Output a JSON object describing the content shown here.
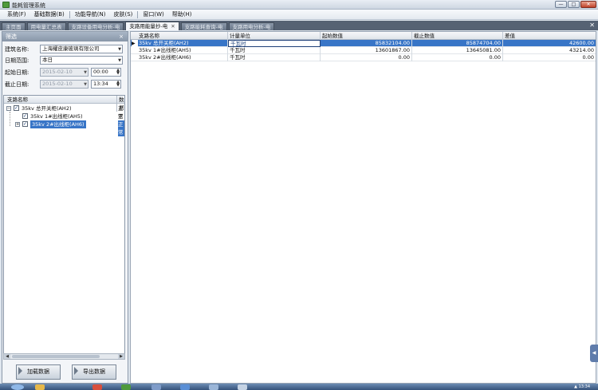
{
  "window": {
    "title": "能耗管理系统",
    "min": "—",
    "max": "□",
    "close": "✕"
  },
  "menu": [
    "系统(F)",
    "基础数据(B)",
    "功能导航(N)",
    "皮肤(S)",
    "窗口(W)",
    "帮助(H)"
  ],
  "tabs": [
    {
      "label": "主页面",
      "active": false
    },
    {
      "label": "用电量汇总表",
      "active": false
    },
    {
      "label": "支路设备用电分析-电",
      "active": false
    },
    {
      "label": "支路用能量抄-电",
      "active": true
    },
    {
      "label": "支路能耗查询-电",
      "active": false
    },
    {
      "label": "支路用电分析-电",
      "active": false
    }
  ],
  "tab_close_glyph": "✕",
  "filter": {
    "header": "筛选",
    "pin": "×",
    "building_label": "建筑名称:",
    "building_value": "上海耀皮康玻璃有限公司",
    "range_label": "日期范围:",
    "range_value": "本日",
    "start_label": "起始日期:",
    "start_date": "2015-02-10",
    "start_time": "00:00",
    "end_label": "截止日期:",
    "end_date": "2015-02-10",
    "end_time": "13:34"
  },
  "tree": {
    "col1": "支路名称",
    "col2": "数据",
    "items": [
      {
        "label": "35kv 总开关柜(AH2)",
        "status": "正常",
        "checked": true,
        "level": 0,
        "expander": "−",
        "selected": false
      },
      {
        "label": "35kv 1#出线柜(AH5)",
        "status": "正常",
        "checked": true,
        "level": 1,
        "expander": "",
        "selected": false
      },
      {
        "label": "35kv 2#出线柜(AH6)",
        "status": "正常",
        "checked": true,
        "level": 1,
        "expander": "+",
        "selected": true
      }
    ]
  },
  "buttons": {
    "load": "加载数据",
    "export": "导出数据"
  },
  "grid": {
    "columns": [
      "支路名称",
      "计量单位",
      "起始数值",
      "截止数值",
      "差值"
    ],
    "rows": [
      {
        "name": "35kv 总开关柜(AH2)",
        "unit": "千瓦时",
        "start": "85832104.00",
        "end": "85874704.00",
        "diff": "42600.00",
        "selected": true
      },
      {
        "name": "35kv 1#出线柜(AH5)",
        "unit": "千瓦时",
        "start": "13601867.00",
        "end": "13645081.00",
        "diff": "43214.00",
        "selected": false
      },
      {
        "name": "35kv 2#出线柜(AH6)",
        "unit": "千瓦时",
        "start": "0.00",
        "end": "0.00",
        "diff": "0.00",
        "selected": false
      }
    ],
    "current_row_glyph": "▶"
  },
  "side_tab": "◀",
  "tray_text": "▲ 13:34"
}
